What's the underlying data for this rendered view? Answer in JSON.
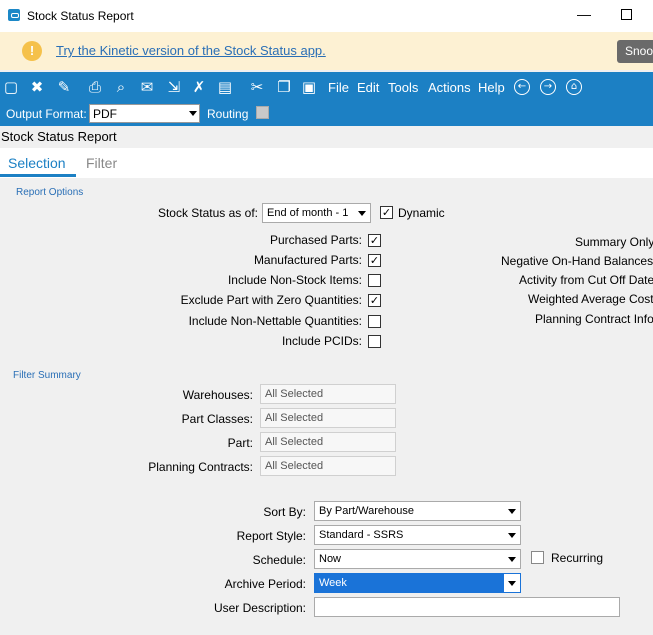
{
  "window": {
    "title": "Stock Status Report"
  },
  "banner": {
    "icon": "!",
    "link_text": "Try the Kinetic version of the Stock Status app.",
    "snooze_label": "Snoo"
  },
  "toolbar": {
    "icons": [
      "new-icon",
      "close-icon",
      "clear-icon",
      "print-icon",
      "print-preview-icon",
      "send-icon",
      "attach-icon",
      "tools-icon",
      "window-icon",
      "cut-icon",
      "copy-icon",
      "paste-icon"
    ],
    "menus": [
      "File",
      "Edit",
      "Tools",
      "Actions",
      "Help"
    ],
    "output_format_label": "Output Format:",
    "output_format_value": "PDF",
    "routing_label": "Routing"
  },
  "header": {
    "title": "Stock Status Report"
  },
  "tabs": [
    {
      "label": "Selection",
      "active": true
    },
    {
      "label": "Filter",
      "active": false
    }
  ],
  "report_options": {
    "section_title": "Report Options",
    "stock_status_label": "Stock Status as of:",
    "stock_status_value": "End of month - 1",
    "dynamic_label": "Dynamic",
    "dynamic_checked": true,
    "left_options": [
      {
        "label": "Purchased Parts:",
        "checked": true
      },
      {
        "label": "Manufactured Parts:",
        "checked": true
      },
      {
        "label": "Include Non-Stock Items:",
        "checked": false
      },
      {
        "label": "Exclude Part with Zero Quantities:",
        "checked": true
      },
      {
        "label": "Include Non-Nettable Quantities:",
        "checked": false
      },
      {
        "label": "Include PCIDs:",
        "checked": false
      }
    ],
    "right_options": [
      "Summary Only",
      "Negative On-Hand Balances",
      "Activity from Cut Off Date",
      "Weighted Average Cost",
      "Planning Contract Info"
    ]
  },
  "filter_summary": {
    "section_title": "Filter Summary",
    "rows": [
      {
        "label": "Warehouses:",
        "value": "All Selected"
      },
      {
        "label": "Part Classes:",
        "value": "All Selected"
      },
      {
        "label": "Part:",
        "value": "All Selected"
      },
      {
        "label": "Planning Contracts:",
        "value": "All Selected"
      }
    ]
  },
  "report_settings": {
    "sort_by_label": "Sort By:",
    "sort_by_value": "By Part/Warehouse",
    "report_style_label": "Report Style:",
    "report_style_value": "Standard - SSRS",
    "schedule_label": "Schedule:",
    "schedule_value": "Now",
    "recurring_label": "Recurring",
    "recurring_checked": false,
    "archive_period_label": "Archive Period:",
    "archive_period_value": "Week",
    "user_description_label": "User Description:",
    "user_description_value": ""
  },
  "colors": {
    "accent": "#1c80c4",
    "banner_bg": "#fdf1d3",
    "link": "#2a6fb6",
    "selection": "#1a73d8"
  }
}
